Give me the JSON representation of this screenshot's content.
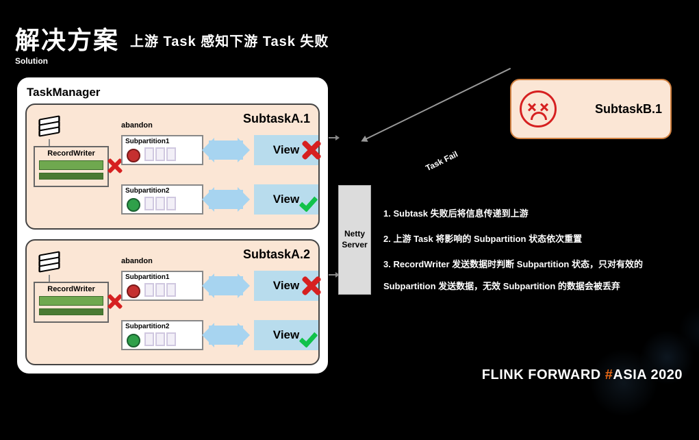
{
  "header": {
    "title_main": "解决方案",
    "title_sub": "上游 Task 感知下游 Task 失败",
    "solution_label": "Solution"
  },
  "diagram": {
    "taskmanager_label": "TaskManager",
    "subtasks": [
      {
        "name": "SubtaskA.1",
        "abandon": "abandon",
        "recordwriter": "RecordWriter",
        "subpartition1": "Subpartition1",
        "subpartition2": "Subpartition2",
        "view": "View"
      },
      {
        "name": "SubtaskA.2",
        "abandon": "abandon",
        "recordwriter": "RecordWriter",
        "subpartition1": "Subpartition1",
        "subpartition2": "Subpartition2",
        "view": "View"
      }
    ],
    "netty": "Netty Server",
    "fail_label": "Task Fail",
    "subtaskb": "SubtaskB.1"
  },
  "explain": {
    "items": [
      "1.   Subtask 失败后将信息传递到上游",
      "2.   上游 Task 将影响的 Subpartition 状态依次重置",
      "3.   RecordWriter 发送数据时判断 Subpartition 状态，只对有效的 Subpartition 发送数据，无效 Subpartition 的数据会被丢弃"
    ]
  },
  "footer": {
    "text1": "FLINK",
    "text2": "FORWARD",
    "hash": "#",
    "text3": "ASIA 2020"
  }
}
